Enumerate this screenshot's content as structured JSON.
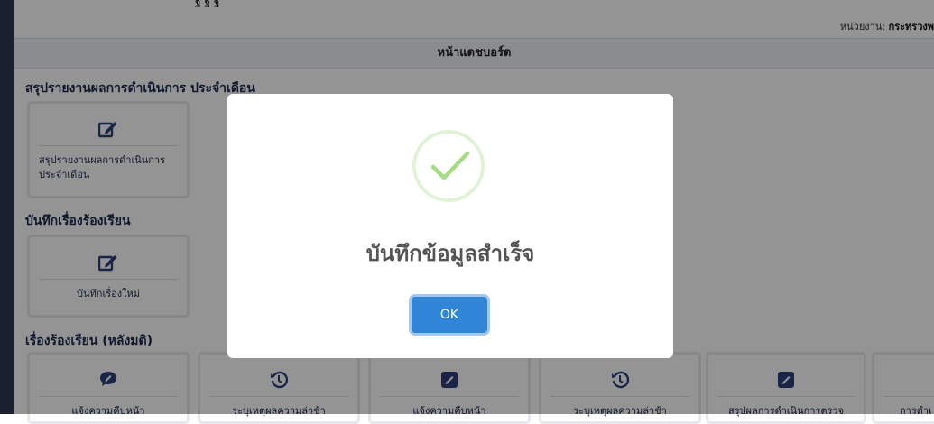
{
  "top_edge": {
    "text": "ฐ                                                    ฐ                          ฐ"
  },
  "header": {
    "org_label": "หน่วยงาน:",
    "org_value": "กระทรวงพ",
    "page_title": "หน้าแดชบอร์ด"
  },
  "sections": [
    {
      "title": "สรุปรายงานผลการดำเนินการ ประจำเดือน",
      "cards": [
        {
          "label": "สรุปรายงานผลการดำเนินการ ประจำเดือน",
          "icon": "edit-icon"
        }
      ]
    },
    {
      "title": "บันทึกเรื่องร้องเรียน",
      "cards": [
        {
          "label": "บันทึกเรื่องใหม่",
          "icon": "edit-icon"
        }
      ]
    },
    {
      "title": "เรื่องร้องเรียน (หลังมติ)",
      "cards": [
        {
          "label": "แจ้งความคืบหน้า",
          "icon": "comment-icon"
        },
        {
          "label": "ระบุเหตุผลความล่าช้า",
          "icon": "history-icon"
        },
        {
          "label": "แจ้งความคืบหน้า",
          "icon": "edit-box-icon"
        },
        {
          "label": "ระบุเหตุผลความล่าช้า",
          "icon": "history-icon"
        },
        {
          "label": "สรุปผลการดำเนินการตรวจ",
          "icon": "edit-box-icon"
        },
        {
          "label": "การดำเ",
          "icon": "edit-box-icon"
        }
      ]
    }
  ],
  "modal": {
    "title": "บันทึกข้อมูลสำเร็จ",
    "ok_label": "OK",
    "icon": "success-check-icon"
  },
  "colors": {
    "primary_button": "#3085d6",
    "success": "#a5dc86",
    "icon_blue": "#2c3e7a",
    "sidebar": "#2c3a55"
  }
}
